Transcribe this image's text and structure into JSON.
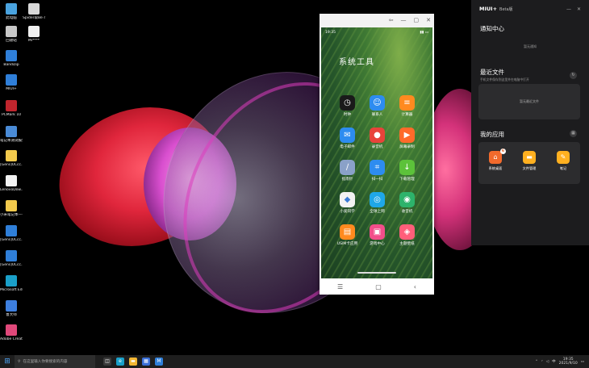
{
  "desktop": {
    "icons": [
      {
        "label": "此电脑",
        "icon": "computer-icon",
        "color": "#4aa3df"
      },
      {
        "label": "Spider取Be 4.5.9",
        "icon": "spider-app-icon",
        "color": "#d8d8d8"
      },
      {
        "label": "回收站",
        "icon": "recycle-bin-icon",
        "color": "#c8c8c8"
      },
      {
        "label": "Mi****",
        "icon": "file-icon",
        "color": "#f0f0f0"
      },
      {
        "label": "Bandizip",
        "icon": "bandizip-icon",
        "color": "#2f7fd9"
      },
      {
        "label": "MIUI+",
        "icon": "miui-plus-icon",
        "color": "#2f7fd9"
      },
      {
        "label": "PCMark 10",
        "icon": "pcmark-icon",
        "color": "#c0252d"
      },
      {
        "label": "笔记本测试报告",
        "icon": "notes-icon",
        "color": "#4a8bd6"
      },
      {
        "label": "[Gens]0Ccc...",
        "icon": "document-icon",
        "color": "#f2c94c"
      },
      {
        "label": "LenovoDow...",
        "icon": "document-icon",
        "color": "#f2f2f2"
      },
      {
        "label": "小米笔记本—— ...",
        "icon": "document-icon",
        "color": "#f2c94c"
      },
      {
        "label": "[Gens]0Ccc...",
        "icon": "shortcut-icon",
        "color": "#2f7fd9"
      },
      {
        "label": "[Gens]0Ccc...",
        "icon": "shortcut-icon",
        "color": "#2f7fd9"
      },
      {
        "label": "Microsoft Edge",
        "icon": "edge-icon",
        "color": "#1aa0c9"
      },
      {
        "label": "鲁大师",
        "icon": "ludashi-icon",
        "color": "#3d7fe0"
      },
      {
        "label": "Adobe Creati...",
        "icon": "adobe-icon",
        "color": "#e0487a"
      }
    ]
  },
  "phone_window": {
    "controls": [
      "⇦",
      "—",
      "▢",
      "✕"
    ],
    "status": {
      "time": "19:35",
      "right": "▮▮ ▭"
    },
    "folder_title": "系统工具",
    "apps": [
      {
        "label": "时钟",
        "icon": "clock-icon",
        "glyph": "◷",
        "color": "#1a1a1a"
      },
      {
        "label": "联系人",
        "icon": "contacts-icon",
        "glyph": "☺",
        "color": "#2d8cf0"
      },
      {
        "label": "计算器",
        "icon": "calculator-icon",
        "glyph": "≡",
        "color": "#ff8a1f"
      },
      {
        "label": "电子邮件",
        "icon": "email-icon",
        "glyph": "✉",
        "color": "#2d8cf0"
      },
      {
        "label": "录音机",
        "icon": "recorder-icon",
        "glyph": "●",
        "color": "#e8433a"
      },
      {
        "label": "屏幕录制",
        "icon": "screen-record-icon",
        "glyph": "▶",
        "color": "#ff6a2a"
      },
      {
        "label": "指南针",
        "icon": "compass-icon",
        "glyph": "∕",
        "color": "#8aa1c8"
      },
      {
        "label": "扫一扫",
        "icon": "scanner-icon",
        "glyph": "⌗",
        "color": "#2d8cf0"
      },
      {
        "label": "下载管理",
        "icon": "download-icon",
        "glyph": "↓",
        "color": "#5cc23a"
      },
      {
        "label": "小爱同学",
        "icon": "xiaoai-icon",
        "glyph": "◆",
        "color": "#f2f2f2"
      },
      {
        "label": "全球上网",
        "icon": "global-network-icon",
        "glyph": "◎",
        "color": "#1fa7e8"
      },
      {
        "label": "收音机",
        "icon": "radio-icon",
        "glyph": "◉",
        "color": "#2db36b"
      },
      {
        "label": "USIM卡应用",
        "icon": "sim-card-icon",
        "glyph": "▤",
        "color": "#ff8a1f"
      },
      {
        "label": "游戏中心",
        "icon": "game-center-icon",
        "glyph": "▣",
        "color": "#f24e8a"
      },
      {
        "label": "主题壁纸",
        "icon": "themes-icon",
        "glyph": "◈",
        "color": "#ff5f7a"
      }
    ],
    "nav": {
      "menu": "☰",
      "home": "▢",
      "back": "‹"
    }
  },
  "miui_panel": {
    "brand": "MIUI+",
    "beta": "Beta版",
    "controls": [
      "—",
      "✕"
    ],
    "notifications": {
      "title": "通知中心",
      "empty": "暂无通知"
    },
    "recent_files": {
      "title": "最近文件",
      "subtitle": "手机文件保存到这里并在电脑中打开",
      "empty": "暂无最近文件"
    },
    "my_apps": {
      "title": "我的应用",
      "apps": [
        {
          "label": "系统桌面",
          "icon": "home-icon",
          "glyph": "⌂",
          "color": "#f26a2c",
          "badge": "6"
        },
        {
          "label": "文件管理",
          "icon": "file-manager-icon",
          "glyph": "▬",
          "color": "#ffb020"
        },
        {
          "label": "笔记",
          "icon": "notes-pen-icon",
          "glyph": "✎",
          "color": "#ffb020"
        }
      ]
    }
  },
  "taskbar": {
    "search_placeholder": "在这里输入你要搜索的内容",
    "time": "19:35",
    "date": "2021/9/10",
    "pinned": [
      {
        "icon": "task-view-icon",
        "glyph": "◫",
        "color": "#3a3a3a"
      },
      {
        "icon": "edge-taskbar-icon",
        "glyph": "e",
        "color": "#1aa0c9"
      },
      {
        "icon": "explorer-icon",
        "glyph": "▬",
        "color": "#f2b632"
      },
      {
        "icon": "store-icon",
        "glyph": "▦",
        "color": "#3a6fd8"
      },
      {
        "icon": "miui-taskbar-icon",
        "glyph": "M",
        "color": "#2f7fd9"
      }
    ]
  }
}
